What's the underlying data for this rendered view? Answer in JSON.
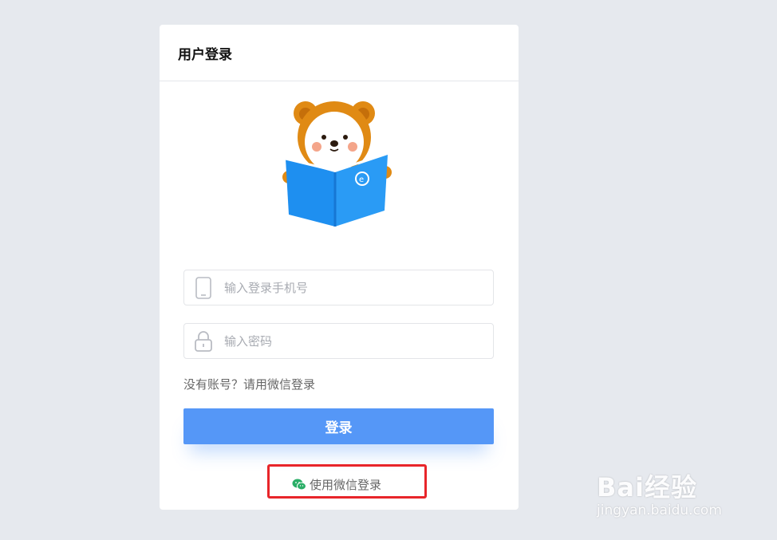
{
  "card": {
    "title": "用户登录"
  },
  "form": {
    "phone_placeholder": "输入登录手机号",
    "password_placeholder": "输入密码",
    "hint": "没有账号？请用微信登录",
    "login_label": "登录",
    "wechat_label": "使用微信登录"
  },
  "icons": {
    "phone": "phone-icon",
    "lock": "lock-icon",
    "wechat": "wechat-icon",
    "mascot": "bear-reading-book-mascot"
  },
  "colors": {
    "background": "#e6e9ee",
    "button": "#5597f7",
    "highlight": "#e8252a",
    "wechat": "#2aae67"
  },
  "watermark": {
    "brand": "Bai经验",
    "url": "jingyan.baidu.com"
  }
}
